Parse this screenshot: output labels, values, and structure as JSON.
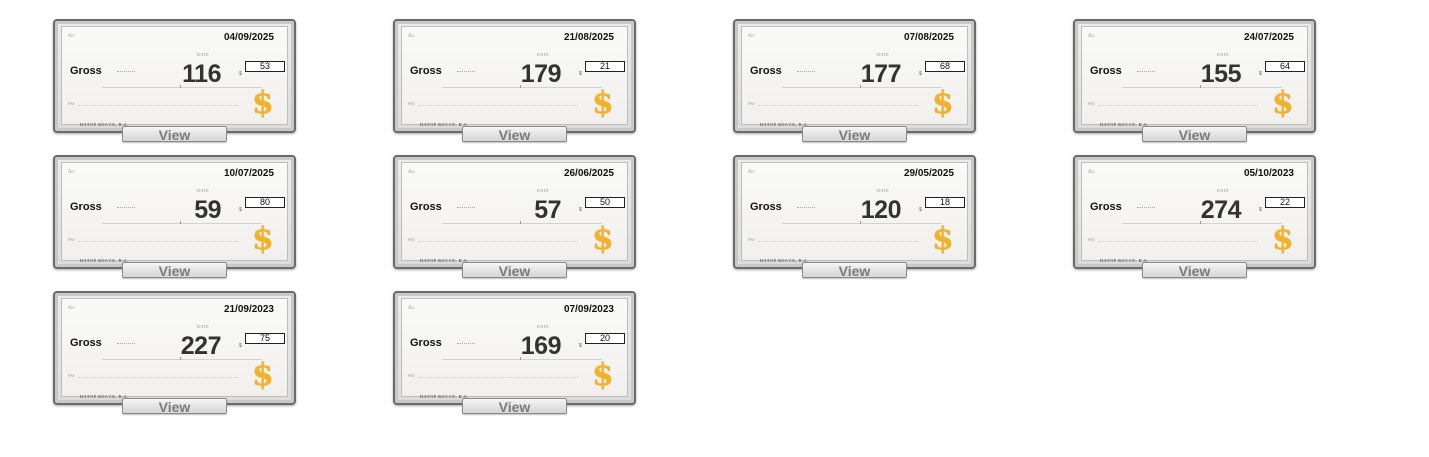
{
  "labels": {
    "gross": "Gross",
    "view": "View",
    "no_prefix": "No.",
    "date_caption": "DATE",
    "pay_prefix": "PAY",
    "bank_name": "HATOP BOCCE, B.A."
  },
  "colors": {
    "dollar_sign": "#f3b22c",
    "amount_text": "#333333",
    "frame": "#6b6b6b"
  },
  "icons": {
    "dollar": "dollar-sign-icon"
  },
  "cheques": [
    {
      "date": "04/09/2025",
      "amount": "116",
      "small": "53"
    },
    {
      "date": "21/08/2025",
      "amount": "179",
      "small": "21"
    },
    {
      "date": "07/08/2025",
      "amount": "177",
      "small": "68"
    },
    {
      "date": "24/07/2025",
      "amount": "155",
      "small": "64"
    },
    {
      "date": "10/07/2025",
      "amount": "59",
      "small": "80"
    },
    {
      "date": "26/06/2025",
      "amount": "57",
      "small": "50"
    },
    {
      "date": "29/05/2025",
      "amount": "120",
      "small": "18"
    },
    {
      "date": "05/10/2023",
      "amount": "274",
      "small": "22"
    },
    {
      "date": "21/09/2023",
      "amount": "227",
      "small": "75"
    },
    {
      "date": "07/09/2023",
      "amount": "169",
      "small": "20"
    }
  ]
}
